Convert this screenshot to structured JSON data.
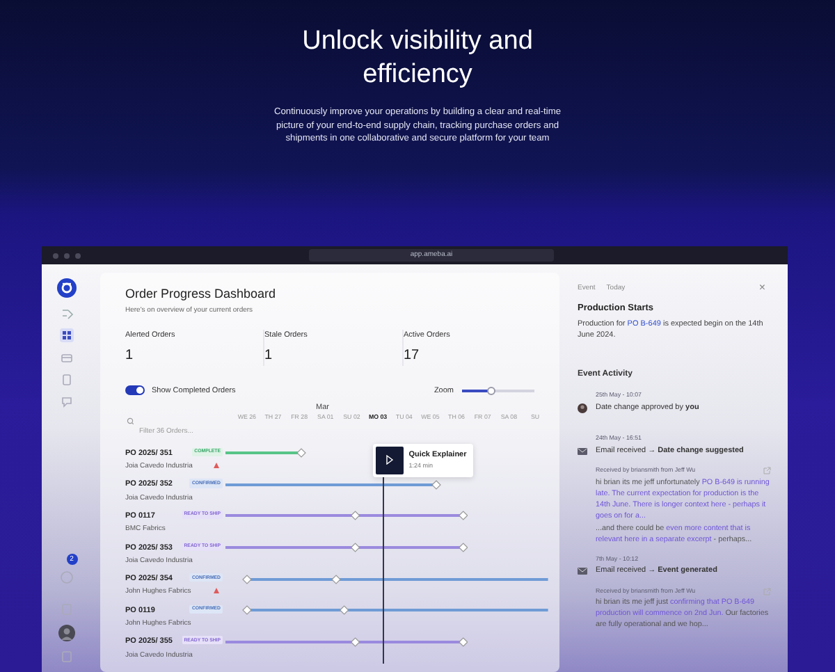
{
  "hero": {
    "title": "Unlock visibility and efficiency",
    "text": "Continuously improve your operations by building a clear and real-time picture of your end-to-end supply chain, tracking purchase orders and shipments in one collaborative and secure platform for your team"
  },
  "window": {
    "url": "app.ameba.ai"
  },
  "sidebar": {
    "items": [
      {
        "kind": "nav",
        "selected": false
      },
      {
        "kind": "nav",
        "selected": true
      },
      {
        "kind": "nav",
        "selected": false
      },
      {
        "kind": "nav",
        "selected": false
      },
      {
        "kind": "nav",
        "selected": false
      }
    ],
    "notification_count": "2"
  },
  "dashboard": {
    "title": "Order Progress Dashboard",
    "subtitle": "Here's on overview of your current orders",
    "stats": [
      {
        "label": "Alerted Orders",
        "value": "1"
      },
      {
        "label": "Stale Orders",
        "value": "1"
      },
      {
        "label": "Active Orders",
        "value": "17"
      }
    ],
    "show_completed": {
      "label": "Show Completed Orders",
      "on": true
    },
    "zoom": {
      "label": "Zoom",
      "level": 0.4
    },
    "filter": {
      "placeholder": "Filter 36 Orders..."
    },
    "month": "Mar",
    "days": [
      {
        "label": "WE 26",
        "selected": false
      },
      {
        "label": "TH 27",
        "selected": false
      },
      {
        "label": "FR 28",
        "selected": false
      },
      {
        "label": "SA 01",
        "selected": false
      },
      {
        "label": "SU 02",
        "selected": false
      },
      {
        "label": "MO 03",
        "selected": true
      },
      {
        "label": "TU 04",
        "selected": false
      },
      {
        "label": "WE 05",
        "selected": false
      },
      {
        "label": "TH 06",
        "selected": false
      },
      {
        "label": "FR 07",
        "selected": false
      },
      {
        "label": "SA 08",
        "selected": false
      },
      {
        "label": "SU",
        "selected": false
      }
    ],
    "orders": [
      {
        "name": "PO 2025/ 351",
        "company": "Joia Cavedo Industria",
        "status": "COMPLETE",
        "kind": "complete",
        "alert": true
      },
      {
        "name": "PO 2025/ 352",
        "company": "Joia Cavedo Industria",
        "status": "CONFIRMED",
        "kind": "confirmed",
        "alert": false
      },
      {
        "name": "PO 0117",
        "company": "BMC Fabrics",
        "status": "READY TO SHIP",
        "kind": "ready",
        "alert": false
      },
      {
        "name": "PO 2025/ 353",
        "company": "Joia Cavedo Industria",
        "status": "READY TO SHIP",
        "kind": "ready",
        "alert": false
      },
      {
        "name": "PO 2025/ 354",
        "company": "John Hughes Fabrics",
        "status": "CONFIRMED",
        "kind": "confirmed",
        "alert": true
      },
      {
        "name": "PO 0119",
        "company": "John Hughes Fabrics",
        "status": "CONFIRMED",
        "kind": "confirmed",
        "alert": false
      },
      {
        "name": "PO 2025/ 355",
        "company": "Joia Cavedo Industria",
        "status": "READY TO SHIP",
        "kind": "ready",
        "alert": false
      }
    ],
    "video": {
      "title": "Quick Explainer",
      "duration": "1:24 min"
    }
  },
  "event_panel": {
    "tabs": [
      {
        "label": "Event",
        "selected": false
      },
      {
        "label": "Today",
        "selected": false
      }
    ],
    "close": "×",
    "title": "Production Starts",
    "description": [
      {
        "text": "Production for ",
        "highlight": false
      },
      {
        "text": "PO B-649",
        "highlight": true
      },
      {
        "text": " is expected begin on the 14th June 2024.",
        "highlight": false
      }
    ],
    "activity_title": "Event Activity",
    "activities": [
      {
        "kind": "approval",
        "time": "25th May - 10:07",
        "text": "Date change approved by **you**"
      },
      {
        "kind": "email",
        "time": "24th May - 16:51",
        "text": "Email received → **Date change suggested**",
        "received": "Received by briansmith from Jeff Wu",
        "excerpts": [
          [
            {
              "text": "hi brian its me jeff unfortunately ",
              "highlight": false
            },
            {
              "text": "PO B-649 is running late. The current expectation for production is the 14th June. There is longer context here - perhaps it goes on for a...",
              "highlight": true
            }
          ],
          [
            {
              "text": "...and there could be ",
              "highlight": false
            },
            {
              "text": "even more content that is relevant here in a separate excerpt",
              "highlight": true
            },
            {
              "text": " - perhaps...",
              "highlight": false
            }
          ]
        ]
      },
      {
        "kind": "email",
        "time": "7th May - 10:12",
        "text": "Email received → **Event generated**",
        "received": "Received by briansmith from Jeff Wu",
        "excerpts": [
          [
            {
              "text": "hi brian its me jeff just ",
              "highlight": false
            },
            {
              "text": "confirming that PO B-649 production will commence on 2nd Jun.",
              "highlight": true
            },
            {
              "text": " Our factories are fully operational and we hop...",
              "highlight": false
            }
          ]
        ]
      }
    ]
  }
}
